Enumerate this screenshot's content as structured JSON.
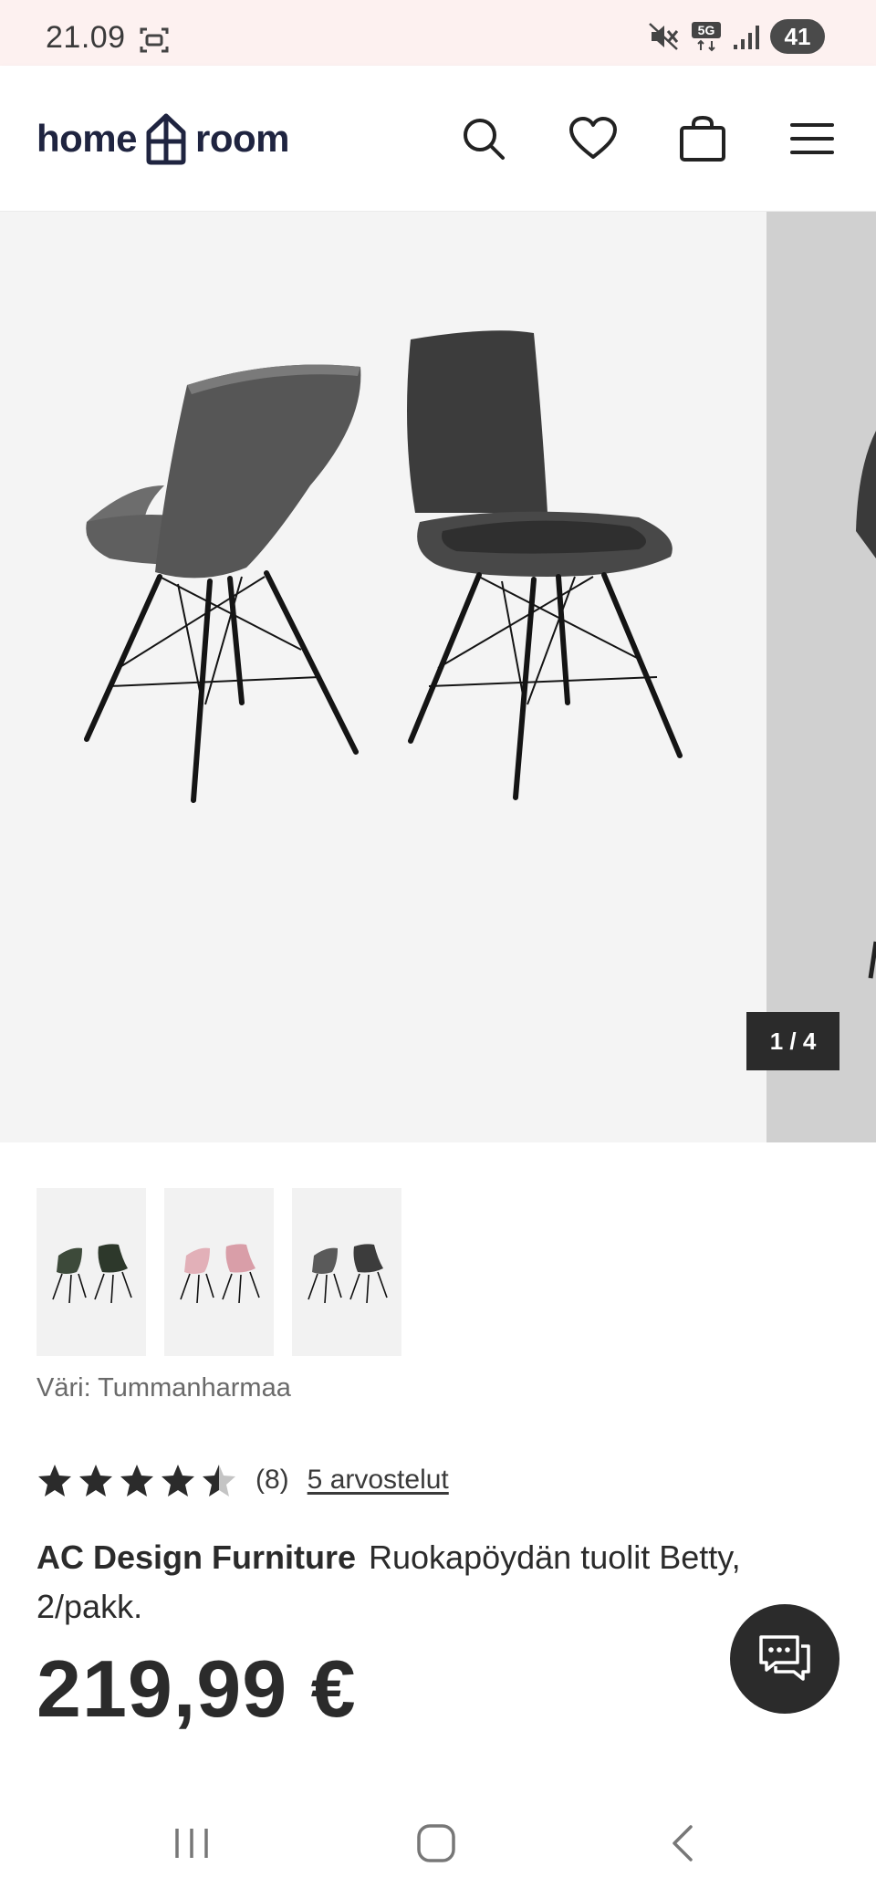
{
  "status_bar": {
    "time": "21.09",
    "battery": "41",
    "network": "5G",
    "icons": [
      "screenshot-icon",
      "mute-icon",
      "5g-icon",
      "signal-icon",
      "battery-icon"
    ]
  },
  "header": {
    "logo_left": "home",
    "logo_right": "room",
    "icons": [
      "search-icon",
      "heart-icon",
      "bag-icon",
      "menu-icon"
    ]
  },
  "gallery": {
    "counter": "1 / 4",
    "current": 1,
    "total": 4
  },
  "thumbnails": [
    {
      "color_name": "green",
      "color": "#3d4a3a"
    },
    {
      "color_name": "pink",
      "color": "#e8b8bf"
    },
    {
      "color_name": "dark grey",
      "color": "#4a4a4a"
    }
  ],
  "product": {
    "color_label": "Väri: Tummanharmaa",
    "rating_value": 4.5,
    "rating_count": "(8)",
    "reviews_link": "5 arvostelut",
    "brand": "AC Design Furniture",
    "name": "Ruokapöydän tuolit Betty, 2/pakk.",
    "price": "219,99 €"
  },
  "colors": {
    "logo": "#1f2440",
    "text": "#2b2b2b",
    "status_bg": "#fdf1f0",
    "gallery_bg": "#f4f4f4"
  }
}
